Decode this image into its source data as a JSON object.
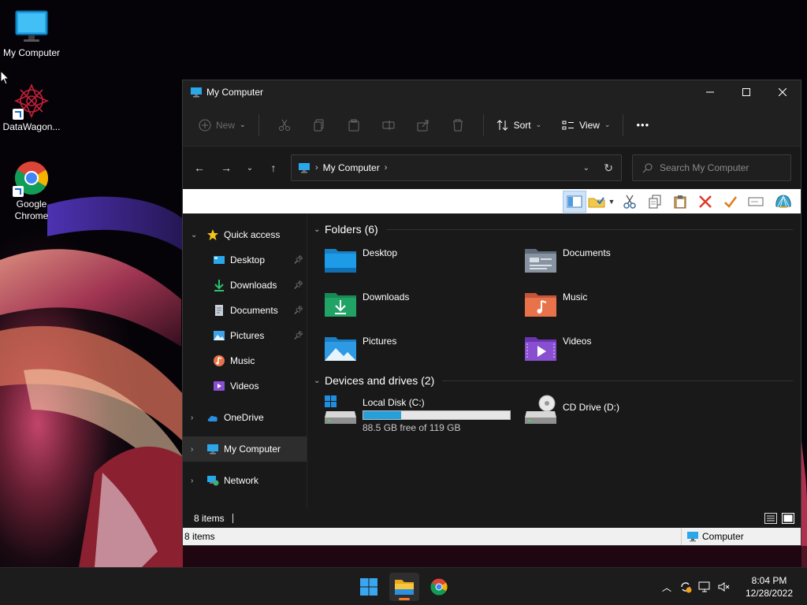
{
  "desktop": {
    "icons": [
      {
        "label": "My Computer"
      },
      {
        "label": "DataWagon..."
      },
      {
        "label": "Google\nChrome"
      }
    ]
  },
  "window": {
    "title": "My Computer",
    "commandbar": {
      "new_label": "New",
      "sort_label": "Sort",
      "view_label": "View",
      "more_label": "•••"
    },
    "address": {
      "crumb": "My Computer"
    },
    "search": {
      "placeholder": "Search My Computer"
    },
    "sidebar": {
      "quick_access": "Quick access",
      "items": [
        {
          "label": "Desktop",
          "pinned": true
        },
        {
          "label": "Downloads",
          "pinned": true
        },
        {
          "label": "Documents",
          "pinned": true
        },
        {
          "label": "Pictures",
          "pinned": true
        },
        {
          "label": "Music",
          "pinned": false
        },
        {
          "label": "Videos",
          "pinned": false
        }
      ],
      "onedrive": "OneDrive",
      "my_computer": "My Computer",
      "network": "Network"
    },
    "content": {
      "folders_header": "Folders (6)",
      "folders": [
        {
          "name": "Desktop"
        },
        {
          "name": "Documents"
        },
        {
          "name": "Downloads"
        },
        {
          "name": "Music"
        },
        {
          "name": "Pictures"
        },
        {
          "name": "Videos"
        }
      ],
      "drives_header": "Devices and drives (2)",
      "drives": [
        {
          "name": "Local Disk (C:)",
          "free_text": "88.5 GB free of 119 GB",
          "used_fraction": 0.256
        },
        {
          "name": "CD Drive (D:)"
        }
      ]
    },
    "status": {
      "items_count": "8 items",
      "classic_items": "8 items",
      "zone_label": "Computer"
    }
  },
  "taskbar": {
    "clock_time": "8:04 PM",
    "clock_date": "12/28/2022"
  },
  "colors": {
    "accent": "#26a0da",
    "folder_blue": "#1e8fd8",
    "folder_green": "#21a366",
    "music_orange": "#e8734a",
    "video_purple": "#8a4fd1"
  }
}
